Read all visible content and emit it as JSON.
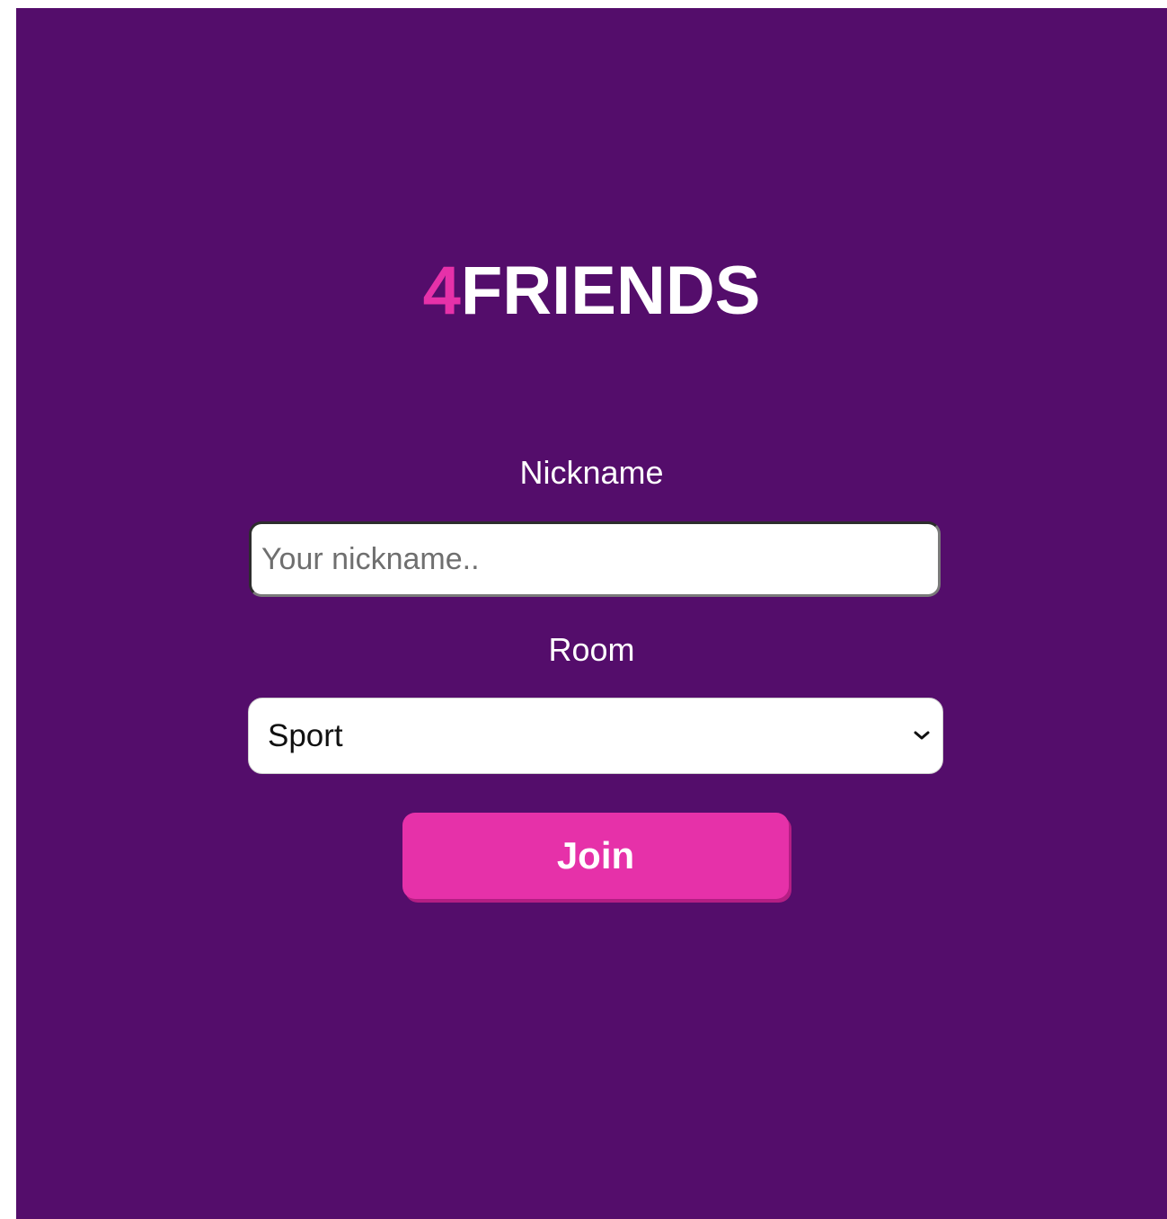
{
  "logo": {
    "accent": "4",
    "name": "FRIENDS"
  },
  "form": {
    "nickname_label": "Nickname",
    "nickname_placeholder": "Your nickname..",
    "nickname_value": "",
    "room_label": "Room",
    "room_selected": "Sport",
    "join_label": "Join"
  },
  "icons": {
    "room_dropdown": "chevron-down-icon"
  },
  "colors": {
    "background": "#540d6b",
    "accent": "#e631a9",
    "text": "#ffffff"
  }
}
